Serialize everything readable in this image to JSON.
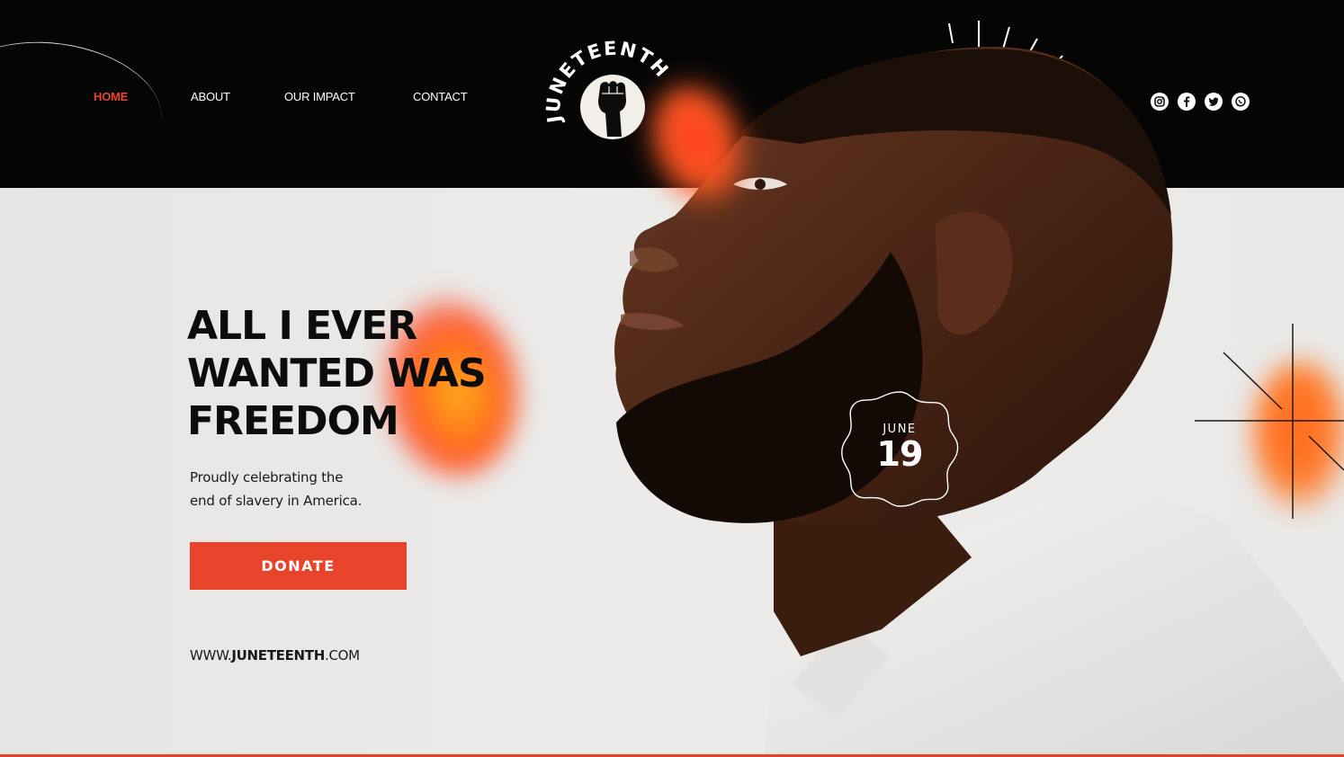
{
  "nav": {
    "items": [
      {
        "label": "HOME",
        "active": true
      },
      {
        "label": "ABOUT",
        "active": false
      },
      {
        "label": "OUR IMPACT",
        "active": false
      },
      {
        "label": "CONTACT",
        "active": false
      }
    ]
  },
  "logo": {
    "text": "JUNETEENTH",
    "icon": "raised-fist-icon"
  },
  "socials": [
    "instagram-icon",
    "facebook-icon",
    "twitter-icon",
    "whatsapp-icon"
  ],
  "hero": {
    "headline_lines": [
      "ALL I EVER",
      "WANTED WAS",
      "FREEDOM"
    ],
    "subtext_lines": [
      "Proudly celebrating the",
      "end of slavery in America."
    ],
    "donate_label": "DONATE",
    "website_prefix": "WWW.",
    "website_bold": "JUNETEENTH",
    "website_suffix": ".COM"
  },
  "badge": {
    "month": "JUNE",
    "day": "19"
  },
  "colors": {
    "accent": "#e8432b",
    "header_bg": "#050505",
    "content_bg": "#e9e8e6",
    "glow_orange": "#ff6a1f"
  }
}
